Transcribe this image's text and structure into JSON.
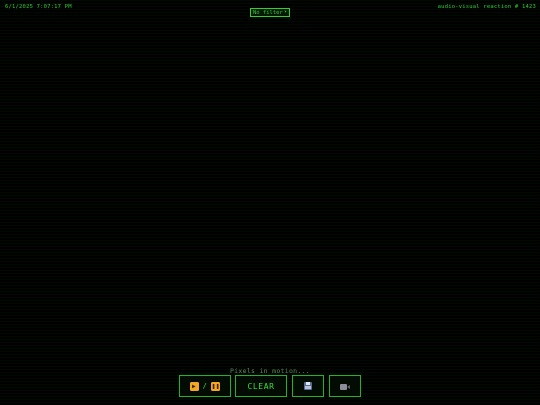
{
  "header": {
    "timestamp": "6/1/2025 7:07:17 PM",
    "reaction_label": "audio-visual reaction # 1423"
  },
  "filter": {
    "selected": "No filter",
    "chevron_icon": "chevron-down-icon"
  },
  "status": {
    "message": "Pixels in motion..."
  },
  "controls": {
    "play_pause": {
      "play_icon": "play-icon",
      "pause_icon": "pause-icon",
      "separator": "/"
    },
    "clear_label": "CLEAR",
    "save_icon": "floppy-disk-icon",
    "record_icon": "video-camera-icon"
  },
  "colors": {
    "background": "#000000",
    "accent": "#35e035",
    "border": "#22b522",
    "status_text": "#5f8f5f",
    "icon_orange": "#f5a623"
  }
}
